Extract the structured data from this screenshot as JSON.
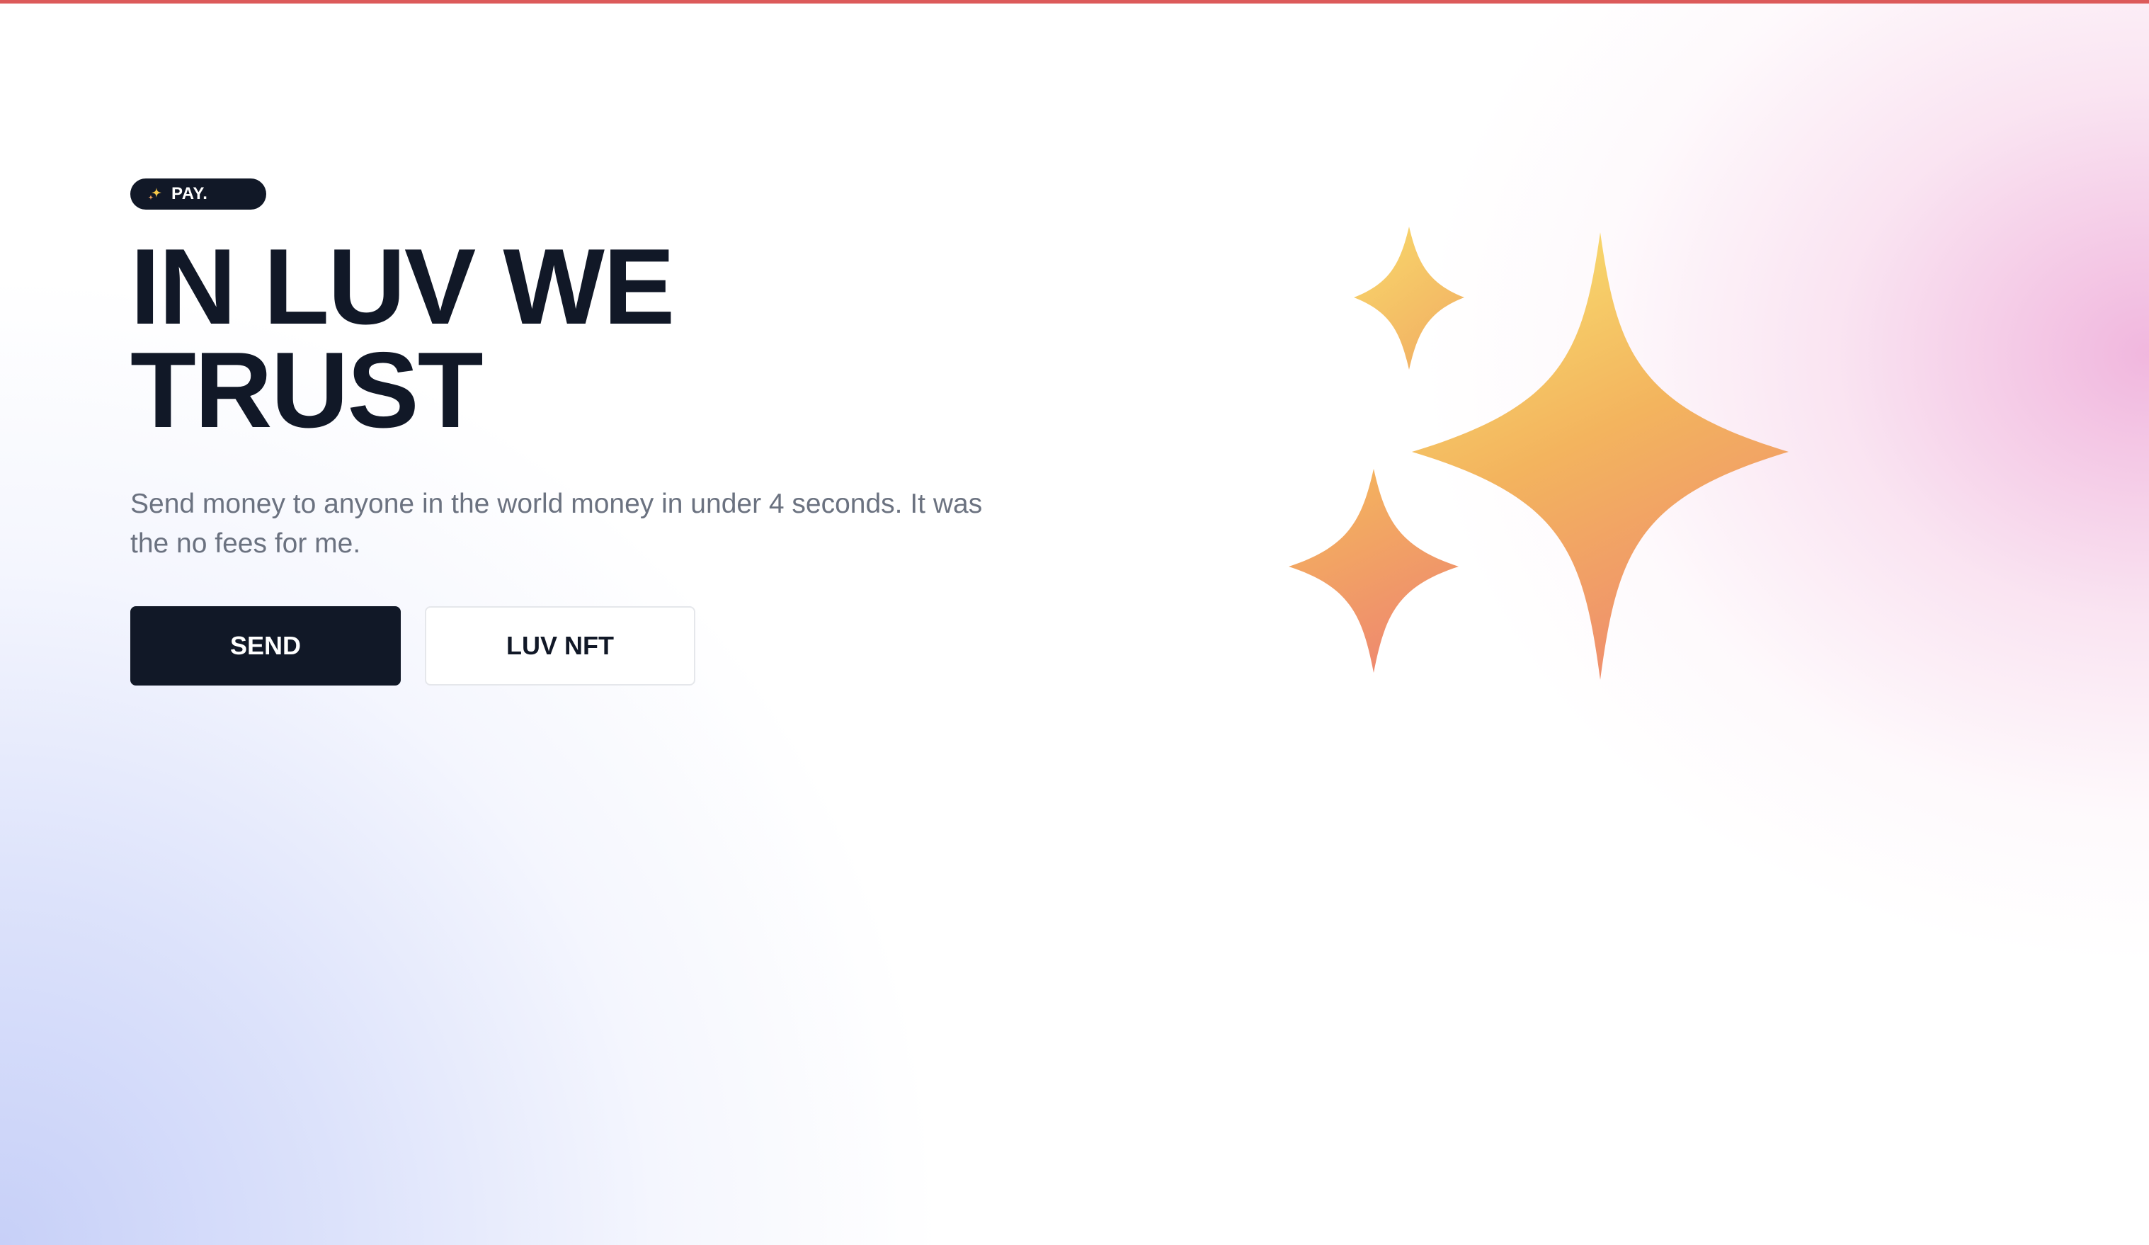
{
  "badge": {
    "icon": "sparkles-icon",
    "label": "PAY."
  },
  "hero": {
    "headline_line1": "IN LUV WE",
    "headline_line2": "TRUST",
    "subtext": "Send money to anyone in the world money in under 4 seconds. It was the no fees for me."
  },
  "actions": {
    "send_label": "SEND",
    "nft_label": "LUV NFT"
  },
  "illustration": {
    "icon": "sparkles-icon"
  },
  "colors": {
    "primary": "#111827",
    "muted_text": "#6b7280",
    "accent_top_bar": "#dc5a5a",
    "sparkle_yellow": "#f7d56a",
    "sparkle_orange": "#f0a15f",
    "sparkle_coral": "#ef8a6f"
  }
}
